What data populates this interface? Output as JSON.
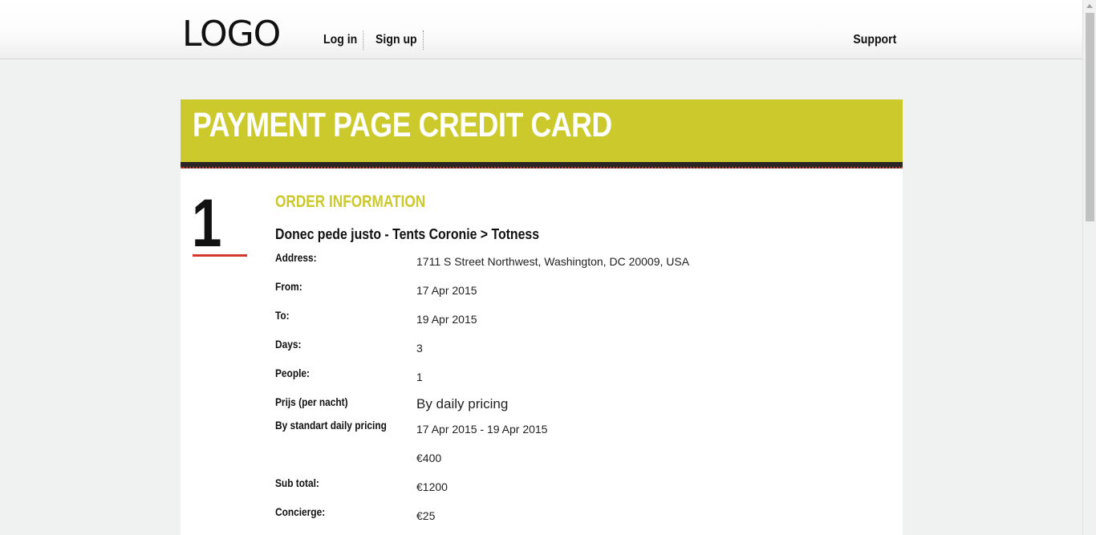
{
  "header": {
    "logo": "LOGO",
    "nav": {
      "login": "Log in",
      "signup": "Sign up"
    },
    "support": "Support"
  },
  "banner": {
    "title": "PAYMENT PAGE CREDIT CARD"
  },
  "step": {
    "number": "1",
    "section_title": "ORDER INFORMATION",
    "order_title": "Donec pede justo - Tents Coronie > Totness",
    "rows": [
      {
        "label": "Address:",
        "value": "1711 S Street Northwest, Washington, DC 20009, USA"
      },
      {
        "label": "From:",
        "value": "17 Apr 2015"
      },
      {
        "label": "To:",
        "value": "19 Apr 2015"
      },
      {
        "label": "Days:",
        "value": "3"
      },
      {
        "label": "People:",
        "value": "1"
      },
      {
        "label": "Prijs (per nacht)",
        "value": "By daily pricing"
      },
      {
        "label": "By standart daily pricing",
        "value": "17 Apr 2015 - 19 Apr 2015"
      },
      {
        "label": "",
        "value": "€400"
      },
      {
        "label": "Sub total:",
        "value": "€1200"
      },
      {
        "label": "Concierge:",
        "value": "€25"
      }
    ]
  }
}
